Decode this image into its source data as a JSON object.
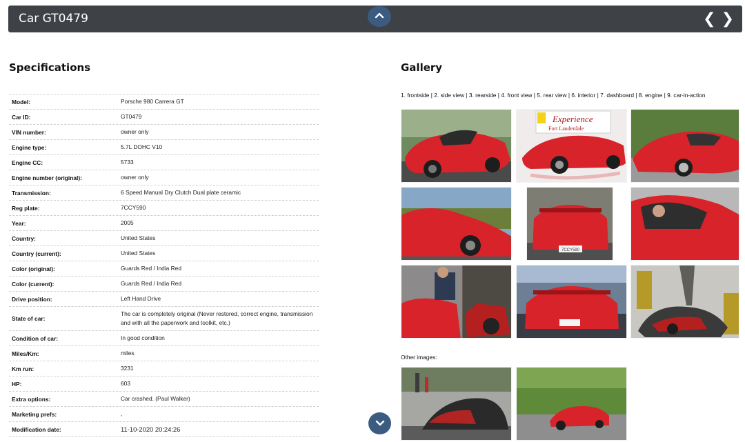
{
  "header": {
    "title": "Car GT0479",
    "prev_label": "❮",
    "next_label": "❯"
  },
  "specifications": {
    "heading": "Specifications",
    "rows": [
      {
        "key": "Model:",
        "value": "Porsche 980 Carrera GT"
      },
      {
        "key": "Car ID:",
        "value": "GT0479"
      },
      {
        "key": "VIN number:",
        "value": "owner only"
      },
      {
        "key": "Engine type:",
        "value": "5.7L DOHC V10"
      },
      {
        "key": "Engine CC:",
        "value": "5733"
      },
      {
        "key": "Engine number (original):",
        "value": "owner only"
      },
      {
        "key": "Transmission:",
        "value": "6 Speed Manual Dry Clutch Dual plate ceramic"
      },
      {
        "key": "Reg plate:",
        "value": "7CCY590"
      },
      {
        "key": "Year:",
        "value": "2005"
      },
      {
        "key": "Country:",
        "value": "United States"
      },
      {
        "key": "Country (current):",
        "value": "United States"
      },
      {
        "key": "Color (original):",
        "value": "Guards Red / India Red"
      },
      {
        "key": "Color (current):",
        "value": "Guards Red / India Red"
      },
      {
        "key": "Drive position:",
        "value": "Left Hand Drive"
      },
      {
        "key": "State of car:",
        "value": "The car is completely original (Never restored, correct engine, transmission and with all the paperwork and toolkit, etc.)"
      },
      {
        "key": "Condition of car:",
        "value": "In good condition"
      },
      {
        "key": "Miles/Km:",
        "value": "miles"
      },
      {
        "key": "Km run:",
        "value": "3231"
      },
      {
        "key": "HP:",
        "value": "603"
      },
      {
        "key": "Extra options:",
        "value": " Car crashed. (Paul Walker)"
      },
      {
        "key": "Marketing prefs:",
        "value": ","
      },
      {
        "key": "Modification date:",
        "value": "11-10-2020 20:24:26"
      }
    ]
  },
  "gallery": {
    "heading": "Gallery",
    "caption": "1. frontside | 2. side view | 3. rearside | 4. front view | 5. rear view | 6. interior | 7. dashboard | 8. engine | 9. car-in-action",
    "images": [
      "frontside",
      "side view",
      "rearside",
      "front view",
      "rear view",
      "interior",
      "dashboard",
      "engine",
      "car-in-action"
    ],
    "dealer_banner": {
      "line1": "Experience",
      "line2": "Fort Lauderdale"
    },
    "plate_text": "7CCY590",
    "other_label": "Other images:"
  },
  "colors": {
    "bar": "#3e4247",
    "button": "#3b5c80",
    "car_red": "#d8232a"
  }
}
